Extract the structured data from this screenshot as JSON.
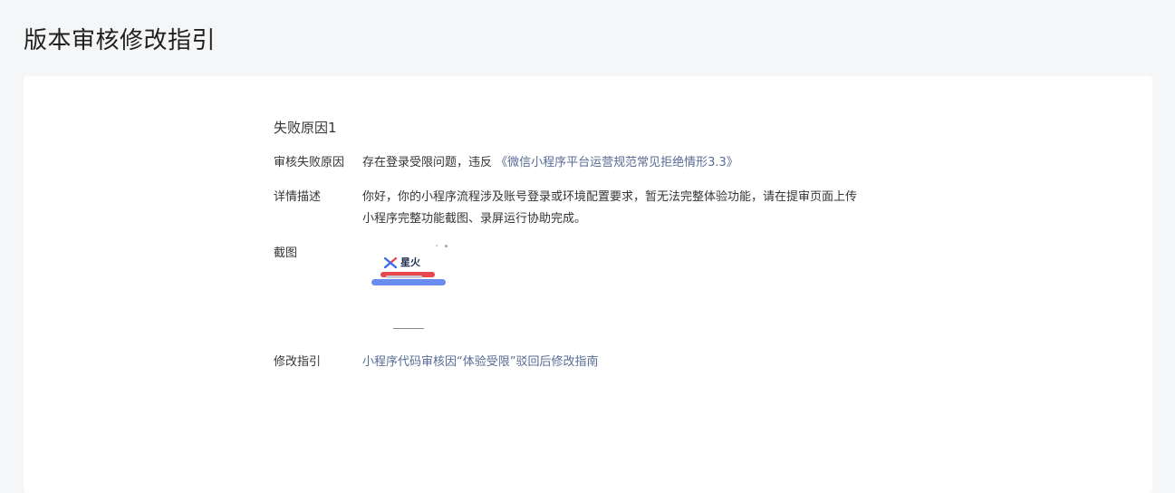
{
  "page": {
    "title": "版本审核修改指引"
  },
  "failure": {
    "section_title": "失败原因1",
    "reason_label": "审核失败原因",
    "reason_text": "存在登录受限问题，违反",
    "reason_link": "《微信小程序平台运营规范常见拒绝情形3.3》",
    "detail_label": "详情描述",
    "detail_line1": "你好，你的小程序流程涉及账号登录或环境配置要求，暂无法完整体验功能，请在提审页面上传",
    "detail_line2": "小程序完整功能截图、录屏运行协助完成。",
    "screenshot_label": "截图",
    "screenshot_logo_text": "星火",
    "guide_label": "修改指引",
    "guide_link": "小程序代码审核因“体验受限”驳回后修改指南"
  },
  "colors": {
    "link": "#576b95",
    "background": "#f5f6f7",
    "card": "#ffffff",
    "thumb_red": "#e8474f",
    "thumb_blue": "#6a8cf0"
  }
}
